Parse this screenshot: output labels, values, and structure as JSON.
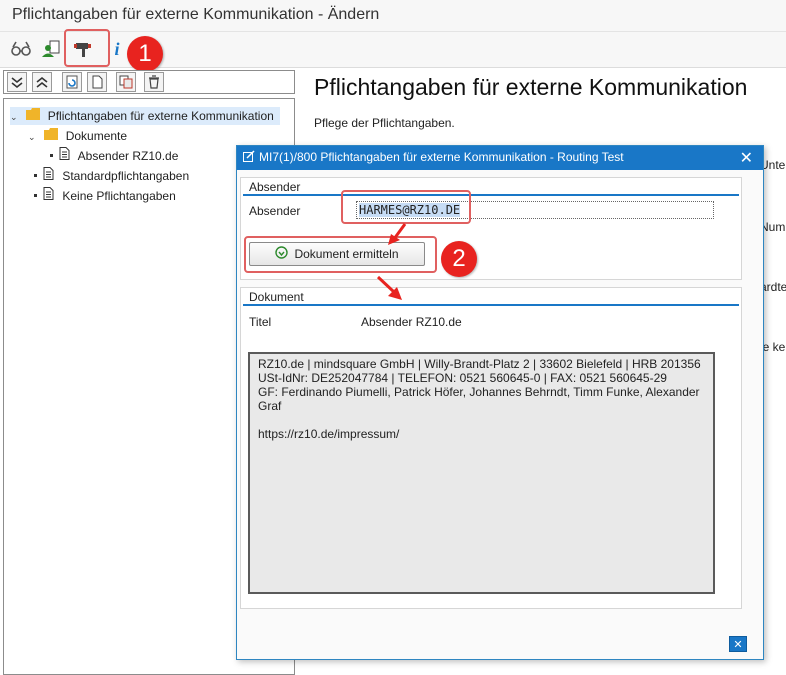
{
  "window": {
    "title": "Pflichtangaben für externe Kommunikation - Ändern"
  },
  "toolbar": {
    "buttons": [
      {
        "icon": "glasses-icon"
      },
      {
        "icon": "user-document-icon"
      },
      {
        "icon": "routing-test-icon"
      },
      {
        "icon": "info-icon"
      }
    ]
  },
  "annotations": {
    "badge_1": "1",
    "badge_2": "2",
    "accent_color": "#e8231f"
  },
  "tree": {
    "root_label": "Pflichtangaben für externe Kommunikation",
    "documents_label": "Dokumente",
    "document_item_label": "Absender RZ10.de",
    "standard_label": "Standardpflichtangaben",
    "none_label": "Keine Pflichtangaben"
  },
  "main": {
    "title": "Pflichtangaben für externe Kommunikation",
    "subtitle": "Pflege der Pflichtangaben.",
    "clipped_1": "Untersc",
    "clipped_2": "Numm",
    "clipped_3": "ardtex",
    "clipped_4": "ie kei"
  },
  "dialog": {
    "title": "MI7(1)/800 Pflichtangaben für externe Kommunikation - Routing Test",
    "header_color": "#1977c7",
    "sender_group": {
      "title": "Absender",
      "field_label": "Absender",
      "field_value": "HARMES@RZ10.DE"
    },
    "determine_button": "Dokument ermitteln",
    "document_group": {
      "title": "Dokument",
      "title_label": "Titel",
      "title_value": "Absender RZ10.de",
      "text": "RZ10.de | mindsquare GmbH | Willy-Brandt-Platz 2 | 33602 Bielefeld | HRB 201356\nUSt-IdNr: DE252047784 | TELEFON: 0521 560645-0 | FAX: 0521 560645-29\nGF: Ferdinando Piumelli, Patrick Höfer, Johannes Behrndt, Timm Funke, Alexander Graf\n\nhttps://rz10.de/impressum/"
    }
  }
}
